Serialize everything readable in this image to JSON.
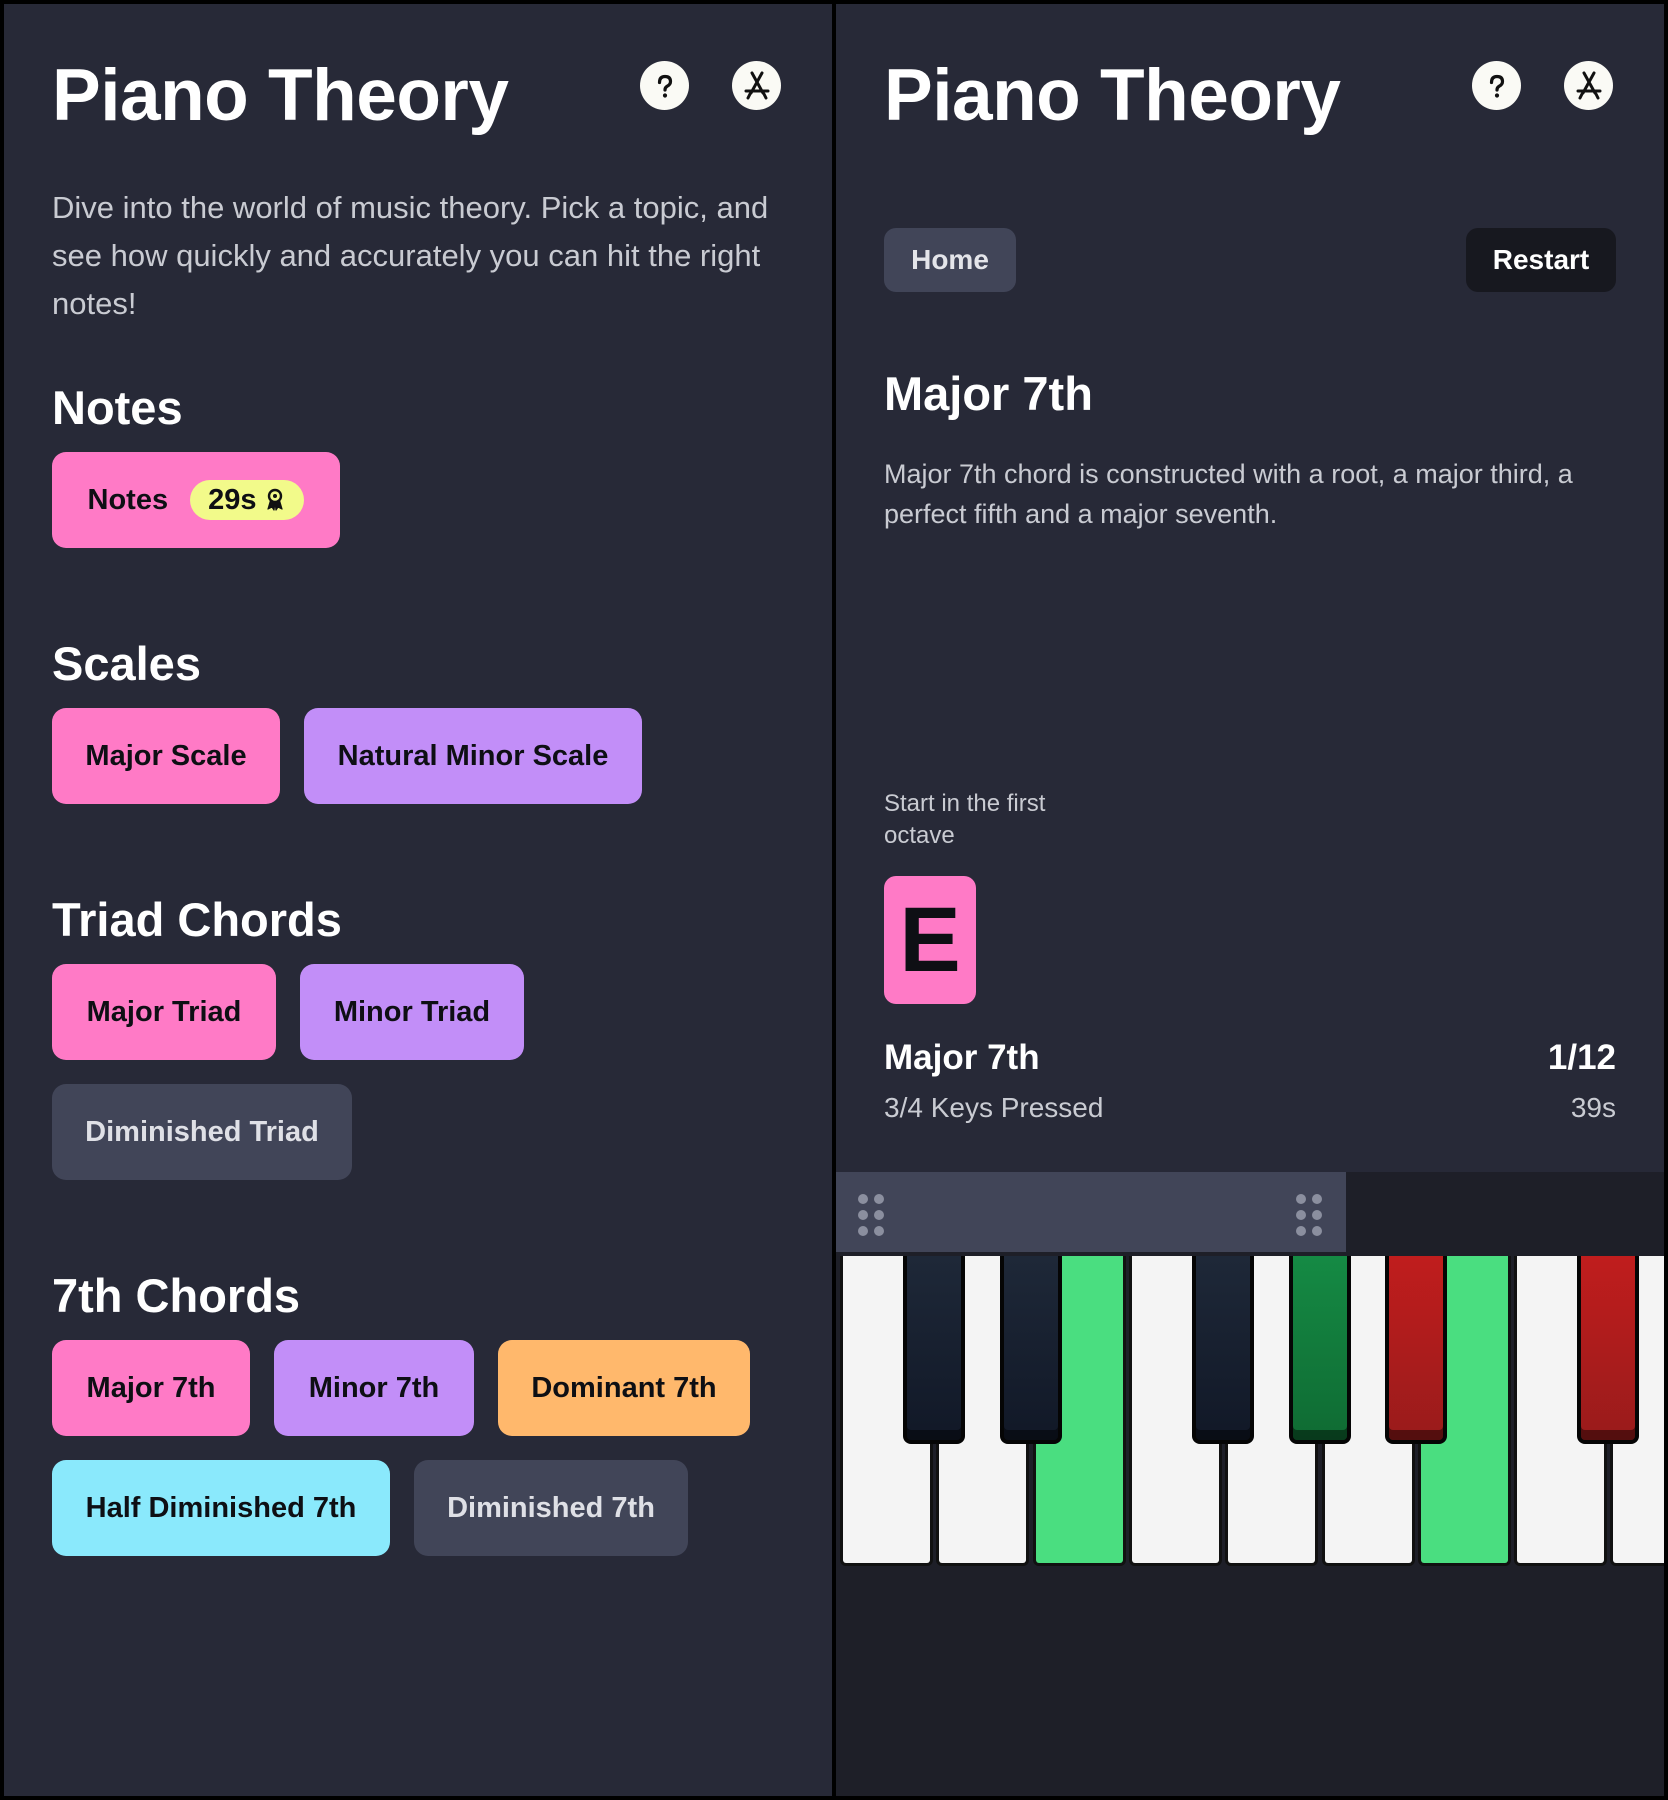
{
  "left": {
    "title": "Piano Theory",
    "intro": "Dive into the world of music theory. Pick a topic, and see how quickly and accurately you can hit the right notes!",
    "sections": {
      "notes": {
        "heading": "Notes",
        "items": {
          "notes": {
            "label": "Notes",
            "badge": "29s",
            "badge_icon": "award-icon"
          }
        }
      },
      "scales": {
        "heading": "Scales",
        "items": {
          "major": "Major Scale",
          "natural_minor": "Natural Minor Scale"
        }
      },
      "triads": {
        "heading": "Triad Chords",
        "items": {
          "major": "Major Triad",
          "minor": "Minor Triad",
          "diminished": "Diminished Triad"
        }
      },
      "sevenths": {
        "heading": "7th Chords",
        "items": {
          "major": "Major 7th",
          "minor": "Minor 7th",
          "dominant": "Dominant 7th",
          "half_diminished": "Half Diminished 7th",
          "diminished": "Diminished 7th"
        }
      }
    }
  },
  "right": {
    "title": "Piano Theory",
    "home_label": "Home",
    "restart_label": "Restart",
    "lesson": {
      "title": "Major 7th",
      "description": "Major 7th chord is constructed with a root, a major third, a perfect fifth and a major seventh.",
      "hint": "Start in the first octave",
      "root_note": "E"
    },
    "status": {
      "chord": "Major 7th",
      "keys_pressed": "3/4 Keys Pressed",
      "progress": "1/12",
      "elapsed": "39s"
    },
    "keyboard": {
      "white_keys": [
        "white",
        "white",
        "green",
        "white",
        "white",
        "white",
        "green",
        "white",
        "white"
      ],
      "black_keys": [
        "black",
        "black",
        "black",
        "green",
        "red",
        "red"
      ]
    }
  },
  "icons": {
    "help": "help-circle-icon",
    "app_store": "app-store-icon",
    "drag": "drag-handle-icon"
  },
  "colors": {
    "background": "#272937",
    "pink": "#ff7ac6",
    "purple": "#c28ef8",
    "orange": "#ffb86c",
    "cyan": "#8ae9fc",
    "slate": "#414558",
    "badge_yellow": "#f2fa8a",
    "key_correct": "#4ade80",
    "key_wrong": "#b91c1c"
  }
}
